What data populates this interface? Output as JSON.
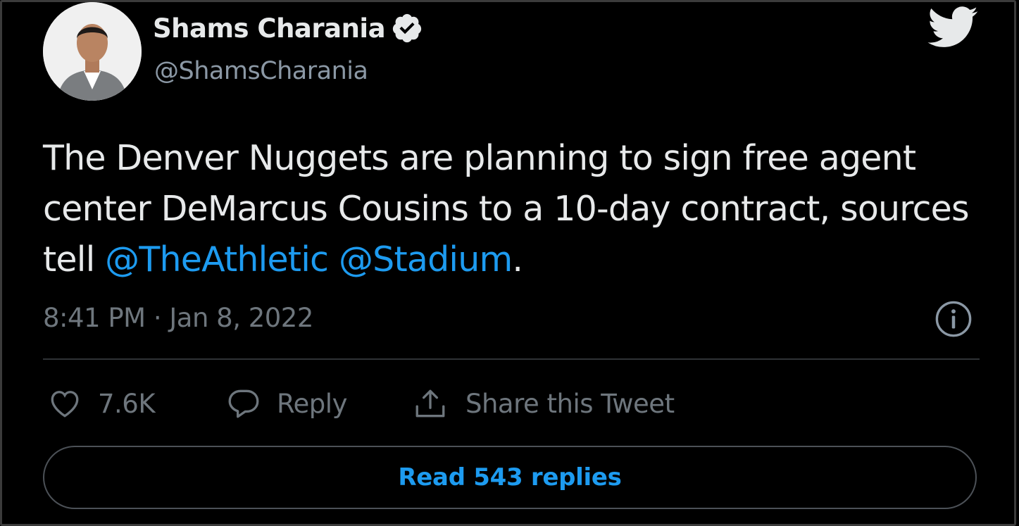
{
  "author": {
    "name": "Shams Charania",
    "handle": "@ShamsCharania",
    "verified": true
  },
  "tweet": {
    "text_before": "The Denver Nuggets are planning to sign free agent center DeMarcus Cousins to a 10-day contract, sources tell ",
    "mention_1": "@TheAthletic",
    "between": " ",
    "mention_2": "@Stadium",
    "text_after": ".",
    "timestamp": "8:41 PM · Jan 8, 2022"
  },
  "actions": {
    "like_count": "7.6K",
    "reply_label": "Reply",
    "share_label": "Share this Tweet"
  },
  "read_replies_label": "Read 543 replies",
  "icons": {
    "logo": "twitter-bird-icon",
    "verified": "verified-badge-icon",
    "info": "info-icon",
    "like": "heart-icon",
    "reply": "speech-bubble-icon",
    "share": "share-upload-icon"
  },
  "colors": {
    "background": "#000000",
    "text": "#e7e9ea",
    "muted": "#6e767d",
    "accent": "#1d9bf0"
  }
}
